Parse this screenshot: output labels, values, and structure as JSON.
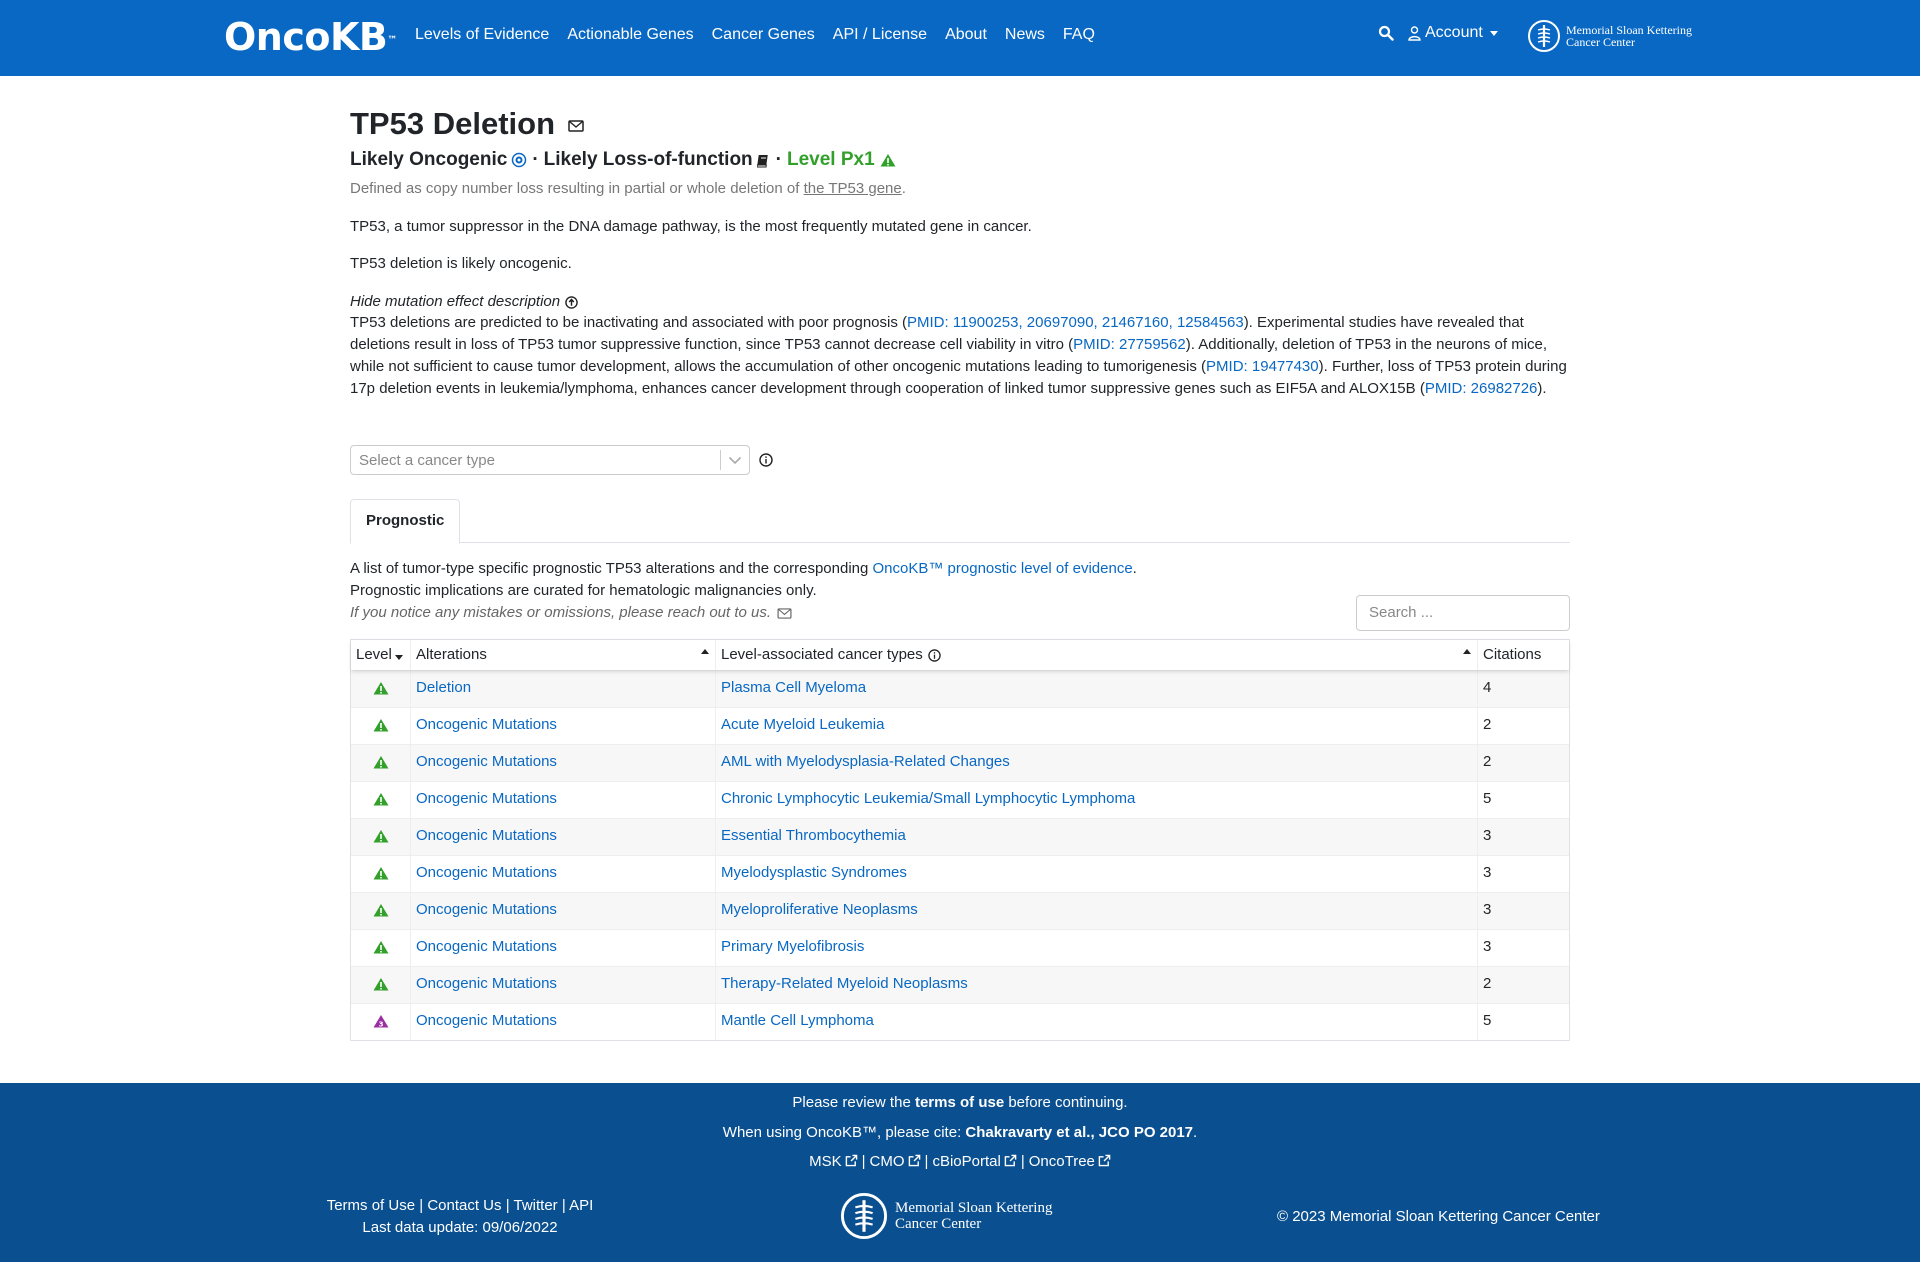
{
  "nav": {
    "logo_text": "OncoKB",
    "logo_tm": "™",
    "items": [
      "Levels of Evidence",
      "Actionable Genes",
      "Cancer Genes",
      "API / License",
      "About",
      "News",
      "FAQ"
    ],
    "account_label": "Account",
    "msk_line1": "Memorial Sloan Kettering",
    "msk_line2": "Cancer Center"
  },
  "header": {
    "gene": "TP53",
    "alteration": "Deletion",
    "oncogenicity": "Likely Oncogenic",
    "mutation_effect": "Likely Loss-of-function",
    "level": "Level Px1",
    "bullet": "·",
    "defined_prefix": "Defined as copy number loss resulting in partial or whole deletion of ",
    "defined_link": "the TP53 gene",
    "defined_suffix": "."
  },
  "summary": {
    "gene_summary": "TP53, a tumor suppressor in the DNA damage pathway, is the most frequently mutated gene in cancer.",
    "variant_summary": "TP53 deletion is likely oncogenic.",
    "hide_label": "Hide mutation effect description"
  },
  "description": {
    "p1": "TP53 deletions are predicted to be inactivating and associated with poor prognosis (",
    "pmid1": "PMID: 11900253, 20697090, 21467160, 12584563",
    "p2": "). Experimental studies have revealed that deletions result in loss of TP53 tumor suppressive function, since TP53 cannot decrease cell viability in vitro (",
    "pmid2": "PMID: 27759562",
    "p3": "). Additionally, deletion of TP53 in the neurons of mice, while not sufficient to cause tumor development, allows the accumulation of other oncogenic mutations leading to tumorigenesis (",
    "pmid3": "PMID: 19477430",
    "p4": "). Further, loss of TP53 protein during 17p deletion events in leukemia/lymphoma, enhances cancer development through cooperation of linked tumor suppressive genes such as EIF5A and ALOX15B (",
    "pmid4": "PMID: 26982726",
    "p5": ")."
  },
  "cancer_select": {
    "placeholder": "Select a cancer type"
  },
  "tabs": {
    "prognostic": "Prognostic"
  },
  "prognostic": {
    "intro_prefix": "A list of tumor-type specific prognostic TP53 alterations and the corresponding ",
    "intro_link": "OncoKB™ prognostic level of evidence",
    "intro_suffix": ".",
    "hema_note": "Prognostic implications are curated for hematologic malignancies only.",
    "notice": "If you notice any mistakes or omissions, please reach out to us.",
    "search_placeholder": "Search ..."
  },
  "table": {
    "headers": {
      "level": "Level",
      "alterations": "Alterations",
      "cancer_types": "Level-associated cancer types",
      "citations": "Citations"
    },
    "rows": [
      {
        "level": "Px1",
        "alteration": "Deletion",
        "cancer_type": "Plasma Cell Myeloma",
        "citations": "4"
      },
      {
        "level": "Px1",
        "alteration": "Oncogenic Mutations",
        "cancer_type": "Acute Myeloid Leukemia",
        "citations": "2"
      },
      {
        "level": "Px1",
        "alteration": "Oncogenic Mutations",
        "cancer_type": "AML with Myelodysplasia-Related Changes",
        "citations": "2"
      },
      {
        "level": "Px1",
        "alteration": "Oncogenic Mutations",
        "cancer_type": "Chronic Lymphocytic Leukemia/Small Lymphocytic Lymphoma",
        "citations": "5"
      },
      {
        "level": "Px1",
        "alteration": "Oncogenic Mutations",
        "cancer_type": "Essential Thrombocythemia",
        "citations": "3"
      },
      {
        "level": "Px1",
        "alteration": "Oncogenic Mutations",
        "cancer_type": "Myelodysplastic Syndromes",
        "citations": "3"
      },
      {
        "level": "Px1",
        "alteration": "Oncogenic Mutations",
        "cancer_type": "Myeloproliferative Neoplasms",
        "citations": "3"
      },
      {
        "level": "Px1",
        "alteration": "Oncogenic Mutations",
        "cancer_type": "Primary Myelofibrosis",
        "citations": "3"
      },
      {
        "level": "Px1",
        "alteration": "Oncogenic Mutations",
        "cancer_type": "Therapy-Related Myeloid Neoplasms",
        "citations": "2"
      },
      {
        "level": "Px3",
        "alteration": "Oncogenic Mutations",
        "cancer_type": "Mantle Cell Lymphoma",
        "citations": "5"
      }
    ]
  },
  "footer": {
    "review_prefix": "Please review the ",
    "review_link": "terms of use",
    "review_suffix": " before continuing.",
    "cite_prefix": "When using OncoKB™, please cite: ",
    "cite_bold": "Chakravarty et al., JCO PO 2017",
    "cite_suffix": ".",
    "links": [
      "MSK",
      "CMO",
      "cBioPortal",
      "OncoTree"
    ],
    "left_links": [
      "Terms of Use",
      "Contact Us",
      "Twitter",
      "API"
    ],
    "last_update": "Last data update: 09/06/2022",
    "copyright": "© 2023 Memorial Sloan Kettering Cancer Center",
    "msk_line1": "Memorial Sloan Kettering",
    "msk_line2": "Cancer Center",
    "separator": "|"
  },
  "colors": {
    "brand_blue": "#0968c3",
    "footer_blue": "#0a4f8f",
    "level_px1": "#33a02c",
    "level_px3": "#9b30a0"
  }
}
